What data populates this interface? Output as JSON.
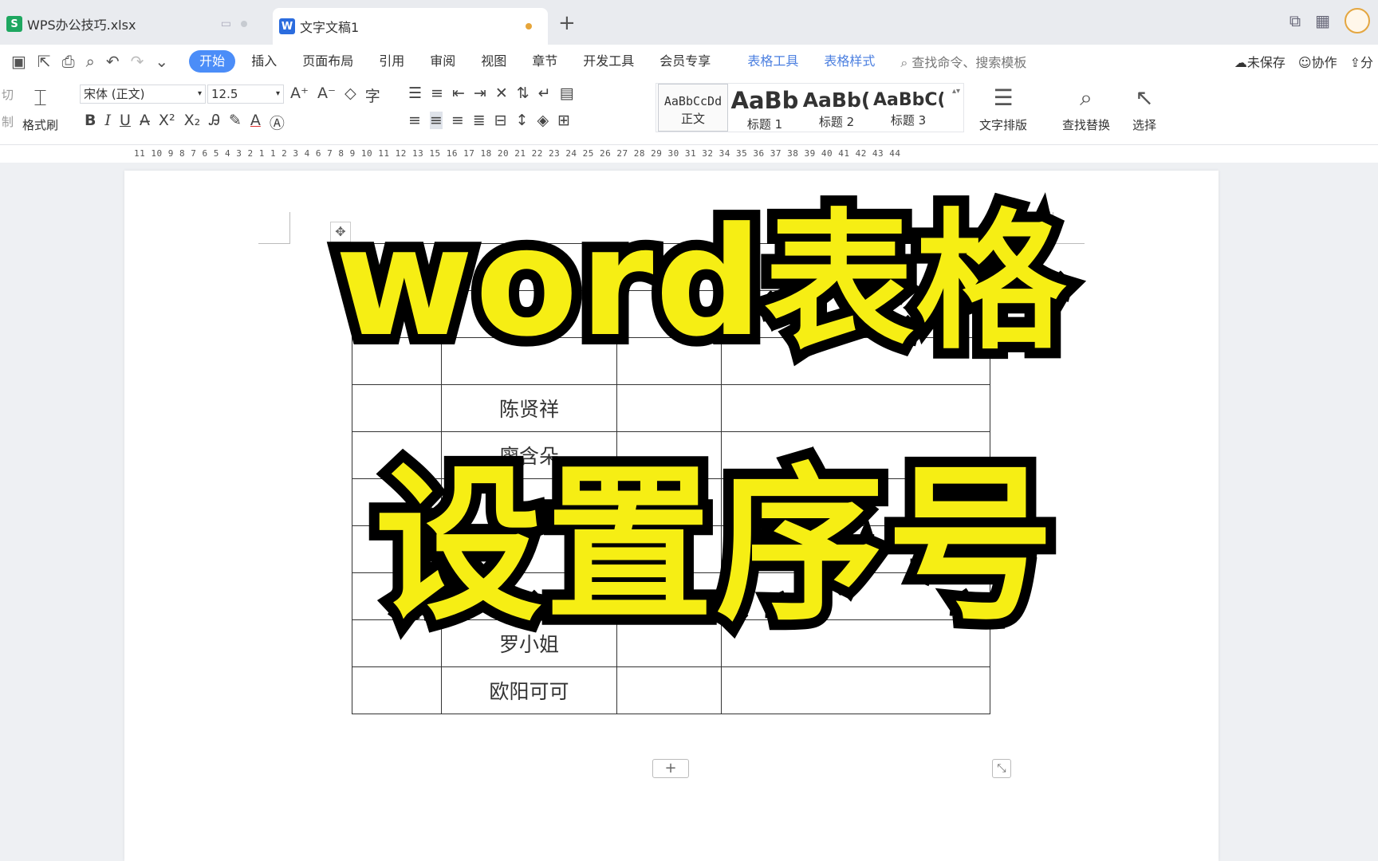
{
  "tabs": [
    {
      "label": "WPS办公技巧.xlsx",
      "icon": "spreadsheet-icon"
    },
    {
      "label": "文字文稿1",
      "icon": "writer-icon"
    }
  ],
  "menu": {
    "items": [
      "开始",
      "插入",
      "页面布局",
      "引用",
      "审阅",
      "视图",
      "章节",
      "开发工具",
      "会员专享"
    ],
    "context_items": [
      "表格工具",
      "表格样式"
    ],
    "search_placeholder": "查找命令、搜索模板",
    "right": [
      "未保存",
      "协作",
      "分"
    ]
  },
  "ribbon": {
    "clipboard": [
      "切",
      "制"
    ],
    "format_painter": "格式刷",
    "font_name": "宋体 (正文)",
    "font_size": "12.5",
    "styles": [
      {
        "preview": "AaBbCcDd",
        "name": "正文"
      },
      {
        "preview": "AaBb",
        "name": "标题 1"
      },
      {
        "preview": "AaBb(",
        "name": "标题 2"
      },
      {
        "preview": "AaBbC(",
        "name": "标题 3"
      }
    ],
    "text_layout": "文字排版",
    "find_replace": "查找替换",
    "select": "选择"
  },
  "ruler": "11 10  9  8  7  6  5  4  3  2  1     1  2  3  4     6  7  8  9 10 11 12 13    15 16 17 18    20 21 22 23 24 25 26 27 28 29 30 31 32    34 35 36 37 38 39 40 41 42 43 44",
  "table": {
    "names": [
      "陈贤祥",
      "廖含朵",
      "罗小姐",
      "欧阳可可"
    ]
  },
  "overlay": {
    "line1": "word表格",
    "line2": "设置序号"
  },
  "colors": {
    "accent": "#4b8df8",
    "overlay_fill": "#f6ee14",
    "overlay_stroke": "#000000"
  }
}
